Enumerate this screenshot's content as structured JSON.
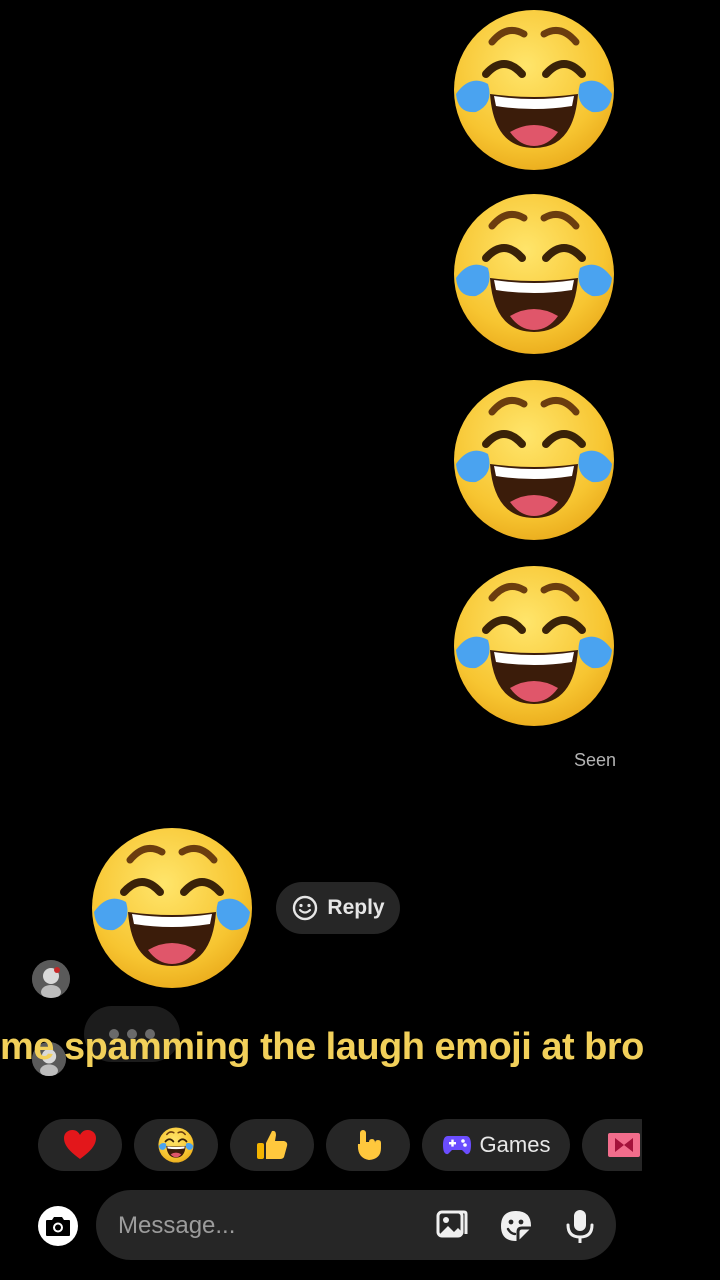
{
  "messages": {
    "sent_emojis": [
      {
        "emoji": "laughing-crying-face"
      },
      {
        "emoji": "laughing-crying-face"
      },
      {
        "emoji": "laughing-crying-face"
      },
      {
        "emoji": "laughing-crying-face"
      }
    ],
    "status": "Seen",
    "received_emoji": "laughing-crying-face",
    "reply_label": "Reply"
  },
  "caption": "me spamming the laugh emoji at bro",
  "quick_reactions": [
    {
      "name": "heart-icon"
    },
    {
      "name": "laughing-icon"
    },
    {
      "name": "thumbs-up-icon"
    },
    {
      "name": "pointing-hand-icon"
    },
    {
      "name": "gamepad-icon",
      "label": "Games"
    },
    {
      "name": "gift-icon"
    }
  ],
  "composer": {
    "placeholder": "Message..."
  },
  "colors": {
    "caption": "#f2d05a",
    "background": "#000000",
    "chip": "#262626",
    "games_accent": "#6b4dff"
  }
}
